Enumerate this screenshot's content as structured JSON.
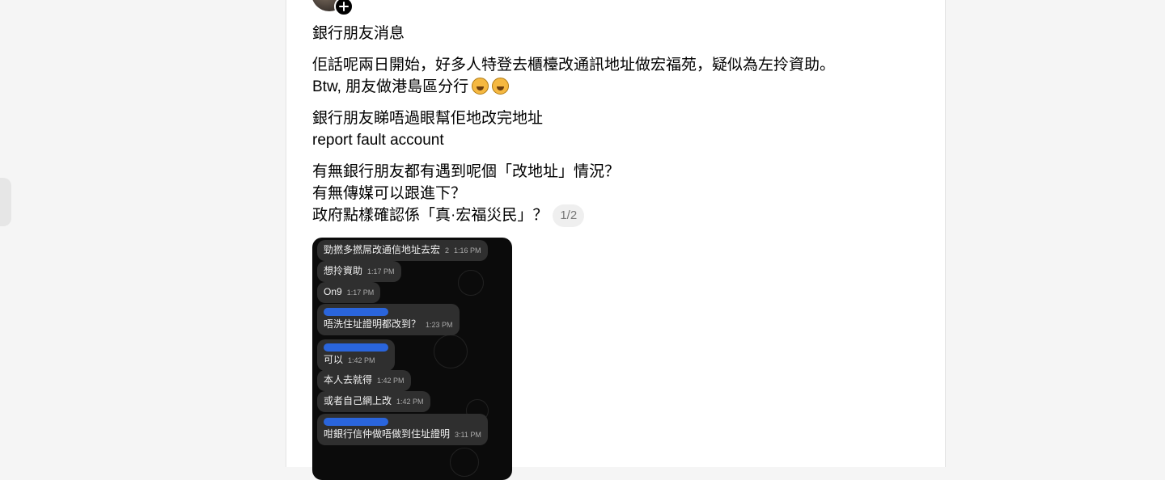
{
  "post": {
    "title_line": "銀行朋友消息",
    "paragraph2": {
      "line1": "佢話呢兩日開始，好多人特登去櫃檯改通訊地址做宏福苑，疑似為左拎資助。",
      "line2": "Btw, 朋友做港島區分行"
    },
    "paragraph3": {
      "line1": "銀行朋友睇唔過眼幫佢地改完地址",
      "line2": "report fault account"
    },
    "paragraph4": {
      "line1": "有無銀行朋友都有遇到呢個「改地址」情況？",
      "line2": "有無傳媒可以跟進下？",
      "line3": "政府點樣確認係「真·宏福災民」？"
    },
    "page_counter": "1/2"
  },
  "chat": {
    "messages": [
      {
        "text": "勁撚多撚屌改通信地址去宏",
        "time": "1:16 PM",
        "extra": "2"
      },
      {
        "text": "想拎資助",
        "time": "1:17 PM"
      },
      {
        "text": "On9",
        "time": "1:17 PM"
      },
      {
        "text": "唔洗住址證明都改到？",
        "time": "1:23 PM"
      },
      {
        "text": "可以",
        "time": "1:42 PM"
      },
      {
        "text": "本人去就得",
        "time": "1:42 PM"
      },
      {
        "text": "或者自己網上改",
        "time": "1:42 PM"
      },
      {
        "text": "咁銀行信仲做唔做到住址證明",
        "time": "3:11 PM"
      }
    ]
  },
  "icons": {
    "follow": "plus-icon",
    "emoji": "rolling-on-floor-laughing-emoji"
  },
  "colors": {
    "background": "#f5f5f5",
    "card": "#ffffff",
    "chat_bg": "#0b0b0b",
    "bubble": "#2f2f2f",
    "redaction": "#2a6cf0"
  }
}
